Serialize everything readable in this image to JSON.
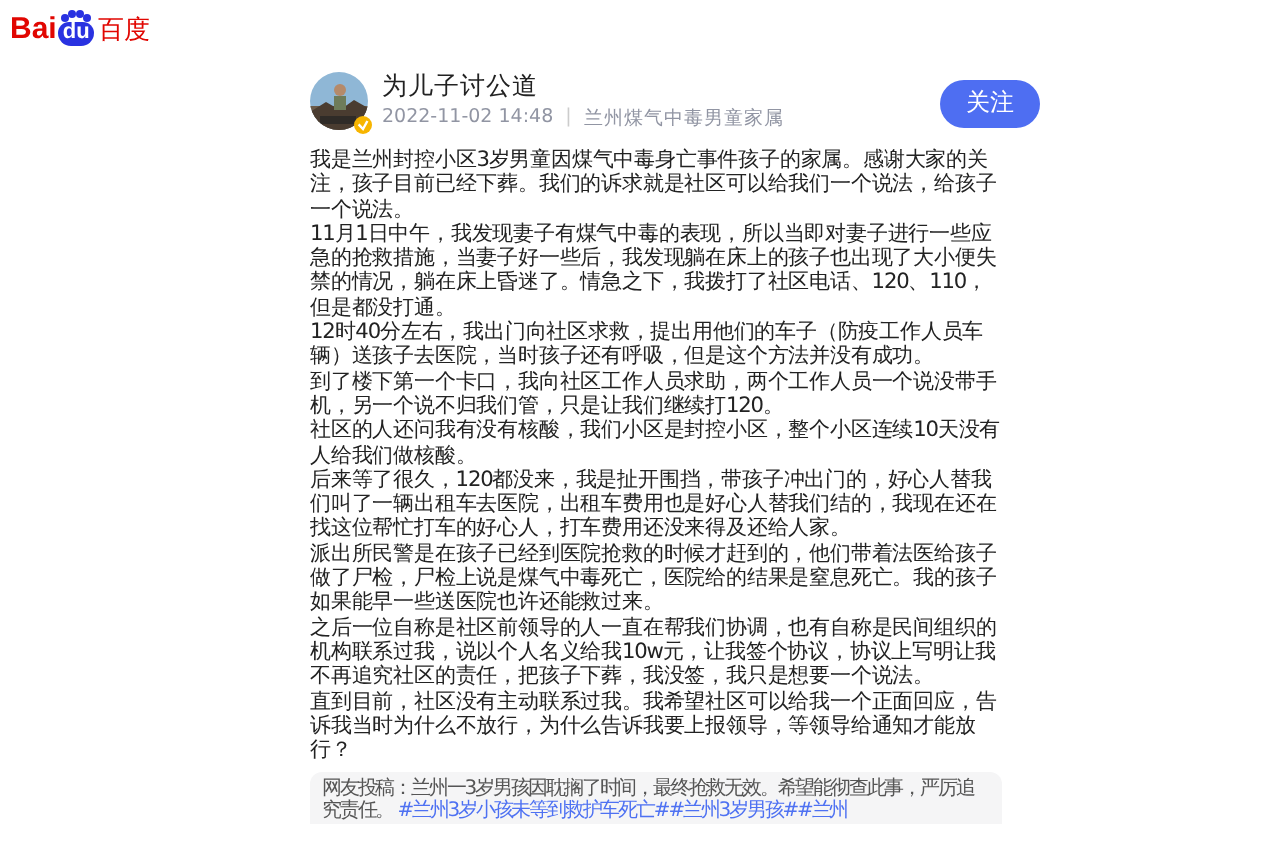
{
  "logo": {
    "left": "Bai",
    "paw": "du",
    "right": "百度"
  },
  "author": {
    "name": "为儿子讨公道",
    "time": "2022-11-02 14:48",
    "separator": "|",
    "description": "兰州煤气中毒男童家属",
    "verified": true
  },
  "follow_button": "关注",
  "paragraphs": [
    "我是兰州封控小区3岁男童因煤气中毒身亡事件孩子的家属。感谢大家的关注，孩子目前已经下葬。我们的诉求就是社区可以给我们一个说法，给孩子一个说法。",
    "11月1日中午，我发现妻子有煤气中毒的表现，所以当即对妻子进行一些应急的抢救措施，当妻子好一些后，我发现躺在床上的孩子也出现了大小便失禁的情况，躺在床上昏迷了。情急之下，我拨打了社区电话、120、110，但是都没打通。",
    "12时40分左右，我出门向社区求救，提出用他们的车子（防疫工作人员车辆）送孩子去医院，当时孩子还有呼吸，但是这个方法并没有成功。",
    "到了楼下第一个卡口，我向社区工作人员求助，两个工作人员一个说没带手机，另一个说不归我们管，只是让我们继续打120。",
    "社区的人还问我有没有核酸，我们小区是封控小区，整个小区连续10天没有人给我们做核酸。",
    "后来等了很久，120都没来，我是扯开围挡，带孩子冲出门的，好心人替我们叫了一辆出租车去医院，出租车费用也是好心人替我们结的，我现在还在找这位帮忙打车的好心人，打车费用还没来得及还给人家。",
    "派出所民警是在孩子已经到医院抢救的时候才赶到的，他们带着法医给孩子做了尸检，尸检上说是煤气中毒死亡，医院给的结果是窒息死亡。我的孩子如果能早一些送医院也许还能救过来。",
    "之后一位自称是社区前领导的人一直在帮我们协调，也有自称是民间组织的机构联系过我，说以个人名义给我10w元，让我签个协议，协议上写明让我不再追究社区的责任，把孩子下葬，我没签，我只是想要一个说法。",
    "直到目前，社区没有主动联系过我。我希望社区可以给我一个正面回应，告诉我当时为什么不放行，为什么告诉我要上报领导，等领导给通知才能放行？"
  ],
  "caption": {
    "text": "网友投稿：兰州一3岁男孩因耽搁了时间，最终抢救无效。希望能彻查此事，严厉追究责任。",
    "hashtags": [
      "#兰州3岁小孩未等到救护车死亡#",
      "#兰州3岁男孩#",
      "#兰州"
    ]
  }
}
